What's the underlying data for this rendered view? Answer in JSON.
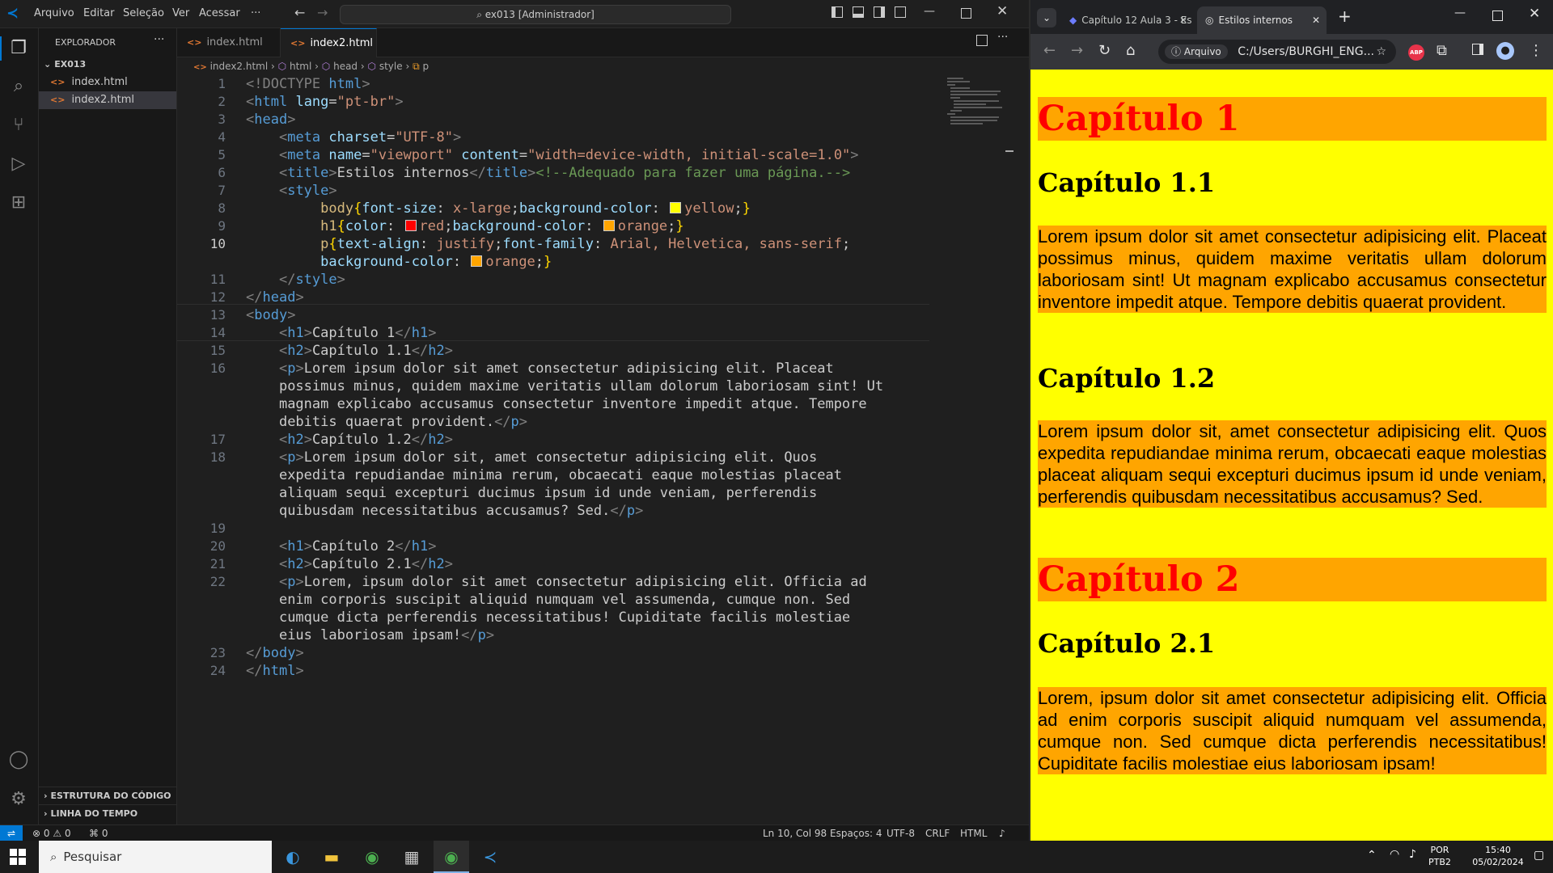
{
  "vscode": {
    "search": "ex013 [Administrador]",
    "menu": [
      "Arquivo",
      "Editar",
      "Seleção",
      "Ver",
      "Acessar",
      "···"
    ],
    "explorer_title": "EXPLORADOR",
    "folder": "EX013",
    "files": [
      "index.html",
      "index2.html"
    ],
    "outline": "ESTRUTURA DO CÓDIGO",
    "timeline": "LINHA DO TEMPO",
    "tabs": [
      "index.html",
      "index2.html"
    ],
    "breadcrumb": [
      "index2.html",
      "html",
      "head",
      "style",
      "p"
    ],
    "line_numbers": [
      "1",
      "2",
      "3",
      "4",
      "5",
      "6",
      "7",
      "8",
      "9",
      "10",
      "",
      "11",
      "12",
      "13",
      "14",
      "15",
      "16",
      "",
      "",
      "",
      "17",
      "18",
      "",
      "",
      "",
      "19",
      "20",
      "21",
      "22",
      "",
      "",
      "",
      "23",
      "24"
    ],
    "code": {
      "l1a": "<!DOCTYPE ",
      "l1b": "html",
      "l1c": ">",
      "l2_tag": "html",
      "l2_attr": "lang",
      "l2_val": "\"pt-br\"",
      "l3_tag": "head",
      "l4_tag": "meta",
      "l4_attr": "charset",
      "l4_val": "\"UTF-8\"",
      "l5_tag": "meta",
      "l5_a1": "name",
      "l5_v1": "\"viewport\"",
      "l5_a2": "content",
      "l5_v2": "\"width=device-width, initial-scale=1.0\"",
      "l6_tag": "title",
      "l6_text": "Estilos internos",
      "l6_comment": "<!--Adequado para fazer uma página.-->",
      "l7_tag": "style",
      "l8_sel": "body",
      "l8_p1": "font-size",
      "l8_v1": "x-large",
      "l8_p2": "background-color",
      "l8_v2": "yellow",
      "l9_sel": "h1",
      "l9_p1": "color",
      "l9_v1": "red",
      "l9_p2": "background-color",
      "l9_v2": "orange",
      "l10_sel": "p",
      "l10_p1": "text-align",
      "l10_v1": "justify",
      "l10_p2": "font-family",
      "l10_v2": "Arial, Helvetica, sans-serif",
      "l10b_p": "background-color",
      "l10b_v": "orange",
      "l11_tag": "style",
      "l12_tag": "head",
      "l13_tag": "body",
      "l14_text": "Capítulo 1",
      "l15_text": "Capítulo 1.1",
      "l16_1": "Lorem ipsum dolor sit amet consectetur adipisicing elit. Placeat",
      "l16_2": "possimus minus, quidem maxime veritatis ullam dolorum laboriosam sint! Ut",
      "l16_3": "magnam explicabo accusamus consectetur inventore impedit atque. Tempore",
      "l16_4": "debitis quaerat provident.",
      "l17_text": "Capítulo 1.2",
      "l18_1": "Lorem ipsum dolor sit, amet consectetur adipisicing elit. Quos",
      "l18_2": "expedita repudiandae minima rerum, obcaecati eaque molestias placeat",
      "l18_3": "aliquam sequi excepturi ducimus ipsum id unde veniam, perferendis",
      "l18_4": "quibusdam necessitatibus accusamus? Sed.",
      "l20_text": "Capítulo 2",
      "l21_text": "Capítulo 2.1",
      "l22_1": "Lorem, ipsum dolor sit amet consectetur adipisicing elit. Officia ad",
      "l22_2": "enim corporis suscipit aliquid numquam vel assumenda, cumque non. Sed",
      "l22_3": "cumque dicta perferendis necessitatibus! Cupiditate facilis molestiae",
      "l22_4": "eius laboriosam ipsam!",
      "l23_tag": "body",
      "l24_tag": "html"
    },
    "status": {
      "errors": "0",
      "warnings": "0",
      "ports": "0",
      "position": "Ln 10, Col 98",
      "spaces": "Espaços: 4",
      "encoding": "UTF-8",
      "eol": "CRLF",
      "language": "HTML"
    }
  },
  "chrome": {
    "tabs": [
      "Capítulo 12 Aula 3 - Es",
      "Estilos internos"
    ],
    "security_label": "Arquivo",
    "url": "C:/Users/BURGHI_ENG...",
    "abp": "ABP",
    "page": {
      "h1_1": "Capítulo 1",
      "h2_1": "Capítulo 1.1",
      "p1": "Lorem ipsum dolor sit amet consectetur adipisicing elit. Placeat possimus minus, quidem maxime veritatis ullam dolorum laboriosam sint! Ut magnam explicabo accusamus consectetur inventore impedit atque. Tempore debitis quaerat provident.",
      "h2_2": "Capítulo 1.2",
      "p2": "Lorem ipsum dolor sit, amet consectetur adipisicing elit. Quos expedita repudiandae minima rerum, obcaecati eaque molestias placeat aliquam sequi excepturi ducimus ipsum id unde veniam, perferendis quibusdam necessitatibus accusamus? Sed.",
      "h1_2": "Capítulo 2",
      "h2_3": "Capítulo 2.1",
      "p3": "Lorem, ipsum dolor sit amet consectetur adipisicing elit. Officia ad enim corporis suscipit aliquid numquam vel assumenda, cumque non. Sed cumque dicta perferendis necessitatibus! Cupiditate facilis molestiae eius laboriosam ipsam!"
    }
  },
  "taskbar": {
    "search": "Pesquisar",
    "lang1": "POR",
    "lang2": "PTB2",
    "time": "15:40",
    "date": "05/02/2024"
  },
  "colors": {
    "vscode_accent": "#0078d4",
    "page_bg": "#ffff00",
    "h1_color": "#ff0000",
    "block_bg": "#ffa500"
  }
}
